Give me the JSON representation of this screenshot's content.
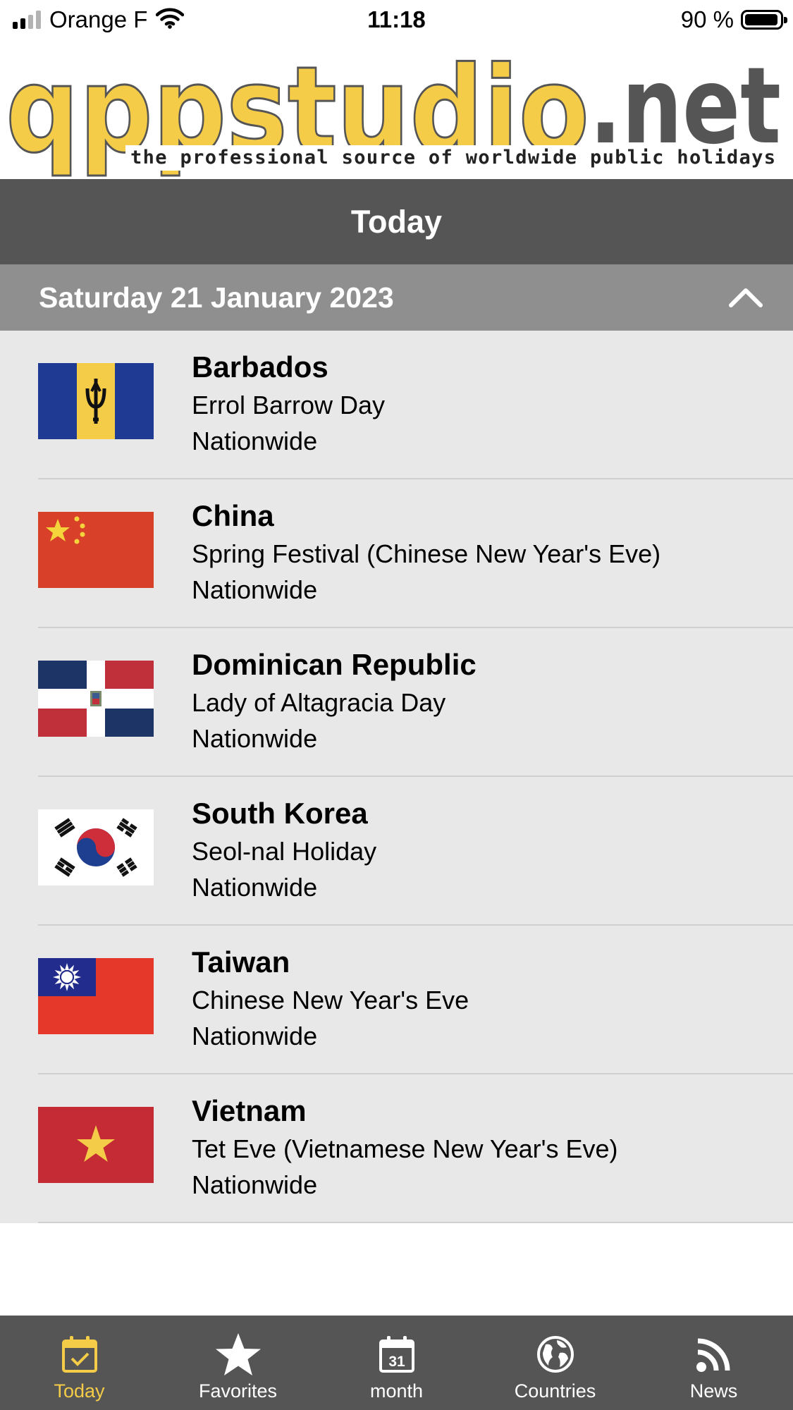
{
  "status_bar": {
    "carrier": "Orange F",
    "time": "11:18",
    "battery": "90 %",
    "battery_level": 0.9
  },
  "logo": {
    "brand_yellow": "qppstudio",
    "brand_grey": ".net",
    "tagline": "the professional source of worldwide public holidays",
    "colors": {
      "yellow": "#f5cc48",
      "grey": "#555555"
    }
  },
  "header": {
    "title": "Today"
  },
  "date_header": {
    "date": "Saturday 21 January 2023",
    "toggle_icon": "chevron-up-icon"
  },
  "holidays": [
    {
      "country": "Barbados",
      "holiday": "Errol Barrow Day",
      "region": "Nationwide",
      "flag": "barbados-flag"
    },
    {
      "country": "China",
      "holiday": "Spring Festival (Chinese New Year's Eve)",
      "region": "Nationwide",
      "flag": "china-flag"
    },
    {
      "country": "Dominican Republic",
      "holiday": "Lady of Altagracia Day",
      "region": "Nationwide",
      "flag": "dominican-republic-flag"
    },
    {
      "country": "South Korea",
      "holiday": "Seol-nal Holiday",
      "region": "Nationwide",
      "flag": "south-korea-flag"
    },
    {
      "country": "Taiwan",
      "holiday": "Chinese New Year's Eve",
      "region": "Nationwide",
      "flag": "taiwan-flag"
    },
    {
      "country": "Vietnam",
      "holiday": "Tet Eve (Vietnamese New Year's Eve)",
      "region": "Nationwide",
      "flag": "vietnam-flag"
    }
  ],
  "tabs": [
    {
      "label": "Today",
      "icon": "calendar-check-icon",
      "active": true
    },
    {
      "label": "Favorites",
      "icon": "star-icon",
      "active": false
    },
    {
      "label": "month",
      "icon": "calendar-31-icon",
      "active": false,
      "icon_text": "31"
    },
    {
      "label": "Countries",
      "icon": "globe-icon",
      "active": false
    },
    {
      "label": "News",
      "icon": "rss-icon",
      "active": false
    }
  ],
  "colors": {
    "tab_active": "#f5cc48",
    "bar_background": "#555555",
    "date_header_background": "#8f8f8f",
    "list_background": "#e8e8e8"
  }
}
